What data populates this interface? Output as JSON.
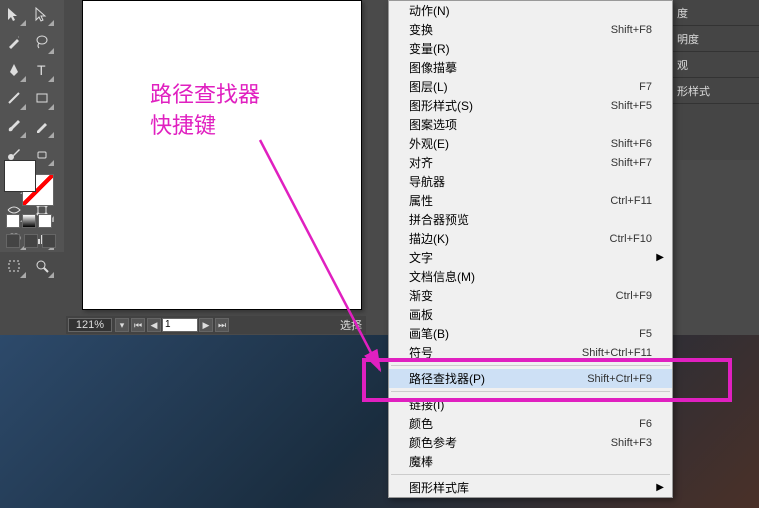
{
  "annotation": {
    "line1": "路径查找器",
    "line2": "快捷键"
  },
  "zoom": "121%",
  "page_number": "1",
  "status_text": "选择",
  "right_panels": [
    {
      "label": "度"
    },
    {
      "label": "明度"
    },
    {
      "label": "观"
    },
    {
      "label": "形样式"
    }
  ],
  "menu": [
    {
      "type": "item",
      "label": "动作(N)",
      "shortcut": ""
    },
    {
      "type": "item",
      "label": "变换",
      "shortcut": "Shift+F8"
    },
    {
      "type": "item",
      "label": "变量(R)",
      "shortcut": ""
    },
    {
      "type": "item",
      "label": "图像描摹",
      "shortcut": ""
    },
    {
      "type": "item",
      "label": "图层(L)",
      "shortcut": "F7"
    },
    {
      "type": "item",
      "label": "图形样式(S)",
      "shortcut": "Shift+F5"
    },
    {
      "type": "item",
      "label": "图案选项",
      "shortcut": ""
    },
    {
      "type": "item",
      "label": "外观(E)",
      "shortcut": "Shift+F6"
    },
    {
      "type": "item",
      "label": "对齐",
      "shortcut": "Shift+F7"
    },
    {
      "type": "item",
      "label": "导航器",
      "shortcut": ""
    },
    {
      "type": "item",
      "label": "属性",
      "shortcut": "Ctrl+F11"
    },
    {
      "type": "item",
      "label": "拼合器预览",
      "shortcut": ""
    },
    {
      "type": "item",
      "label": "描边(K)",
      "shortcut": "Ctrl+F10"
    },
    {
      "type": "item",
      "label": "文字",
      "shortcut": "",
      "submenu": true
    },
    {
      "type": "item",
      "label": "文档信息(M)",
      "shortcut": ""
    },
    {
      "type": "item",
      "label": "渐变",
      "shortcut": "Ctrl+F9"
    },
    {
      "type": "item",
      "label": "画板",
      "shortcut": ""
    },
    {
      "type": "item",
      "label": "画笔(B)",
      "shortcut": "F5"
    },
    {
      "type": "item",
      "label": "符号",
      "shortcut": "Shift+Ctrl+F11"
    },
    {
      "type": "sep"
    },
    {
      "type": "item",
      "label": "路径查找器(P)",
      "shortcut": "Shift+Ctrl+F9",
      "highlighted": true
    },
    {
      "type": "sep"
    },
    {
      "type": "item",
      "label": "链接(I)",
      "shortcut": ""
    },
    {
      "type": "item",
      "label": "颜色",
      "shortcut": "F6"
    },
    {
      "type": "item",
      "label": "颜色参考",
      "shortcut": "Shift+F3"
    },
    {
      "type": "item",
      "label": "魔棒",
      "shortcut": ""
    },
    {
      "type": "sep"
    },
    {
      "type": "item",
      "label": "图形样式库",
      "shortcut": "",
      "submenu": true
    }
  ],
  "tools": [
    "selection",
    "direct-select",
    "magic-wand",
    "lasso",
    "pen",
    "type",
    "line",
    "rectangle",
    "brush",
    "pencil",
    "blob",
    "eraser",
    "rotate",
    "scale",
    "width",
    "warp",
    "shape-builder",
    "perspective",
    "mesh",
    "gradient",
    "eyedropper",
    "blend",
    "symbol",
    "graph",
    "artboard",
    "slice",
    "hand",
    "zoom"
  ]
}
